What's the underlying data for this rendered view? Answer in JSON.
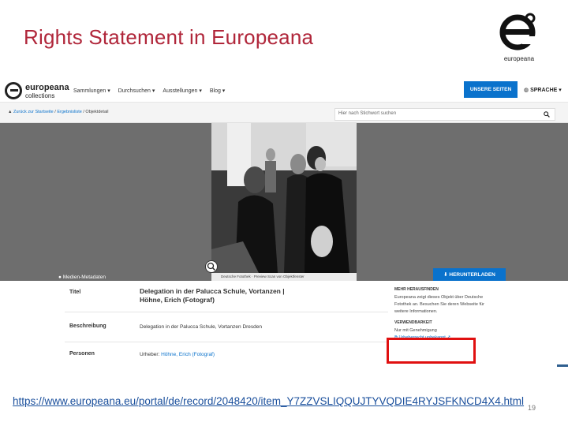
{
  "slide": {
    "title": "Rights Statement in Europeana",
    "logo_text": "europeana",
    "page_number": "19",
    "url": "https://www.europeana.eu/portal/de/record/2048420/item_Y7ZZVSLIQQUJTYVQDIE4RYJSFKNCD4X4.html"
  },
  "site": {
    "logo_word": "europeana",
    "logo_sub": "collections",
    "nav": [
      "Sammlungen ▾",
      "Durchsuchen ▾",
      "Ausstellungen ▾",
      "Blog ▾"
    ],
    "unsere_seiten": "UNSERE SEITEN",
    "sprache": "SPRACHE ▾",
    "breadcrumb": {
      "back": "Zurück zur Startseite",
      "results": "Ergebnisliste",
      "current": "Objektdetail"
    },
    "search_placeholder": "Hier nach Stichwort suchen",
    "photo_caption": "Deutsche Fotothek · Preview Scan von Objektfenster",
    "meta_tab": "Medien-Metadaten",
    "download": "HERUNTERLADEN",
    "metadata": {
      "title_key": "Titel",
      "title_value": "Delegation in der Palucca Schule, Vortanzen | Höhne, Erich (Fotograf)",
      "desc_key": "Beschreibung",
      "desc_value": "Delegation in der Palucca Schule, Vortanzen Dresden",
      "persons_key": "Personen",
      "persons_prefix": "Urheber:",
      "persons_value": "Höhne, Erich (Fotograf)"
    },
    "sidebar": {
      "more_heading": "MEHR HERAUSFINDEN",
      "more_text": "Europeana zeigt dieses Objekt über Deutsche Fotothek an. Besuchen Sie deren Webseite für weitere Informationen.",
      "reuse_heading": "VERWENDBARKEIT",
      "rights_line1": "Nur mit Genehmigung",
      "rights_line2": "Urheberrecht unbekannt"
    }
  },
  "colors": {
    "title_red": "#b0263a",
    "europeana_blue": "#0a72cc",
    "highlight_red": "#e01010"
  }
}
